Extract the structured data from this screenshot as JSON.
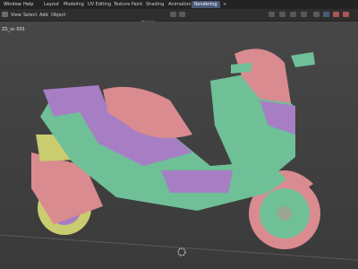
{
  "topbar": {
    "menus": [
      "Window",
      "Help"
    ],
    "tabs": [
      "Layout",
      "Modeling",
      "UV Editing",
      "Texture Paint",
      "Shading",
      "Animation",
      "Rendering"
    ],
    "active_tab": "Rendering",
    "add_tab_label": "+"
  },
  "header": {
    "menus": [
      "View",
      "Select",
      "Add",
      "Object"
    ],
    "orientation": "Global"
  },
  "viewport": {
    "object_label": "ZS_vc 001"
  },
  "colors": {
    "active_tab": "#4a5a7a",
    "mat_green": "#6fbf97",
    "mat_purple": "#a77dc4",
    "mat_pink": "#d98b8f",
    "mat_yellow": "#c9cc6f"
  }
}
